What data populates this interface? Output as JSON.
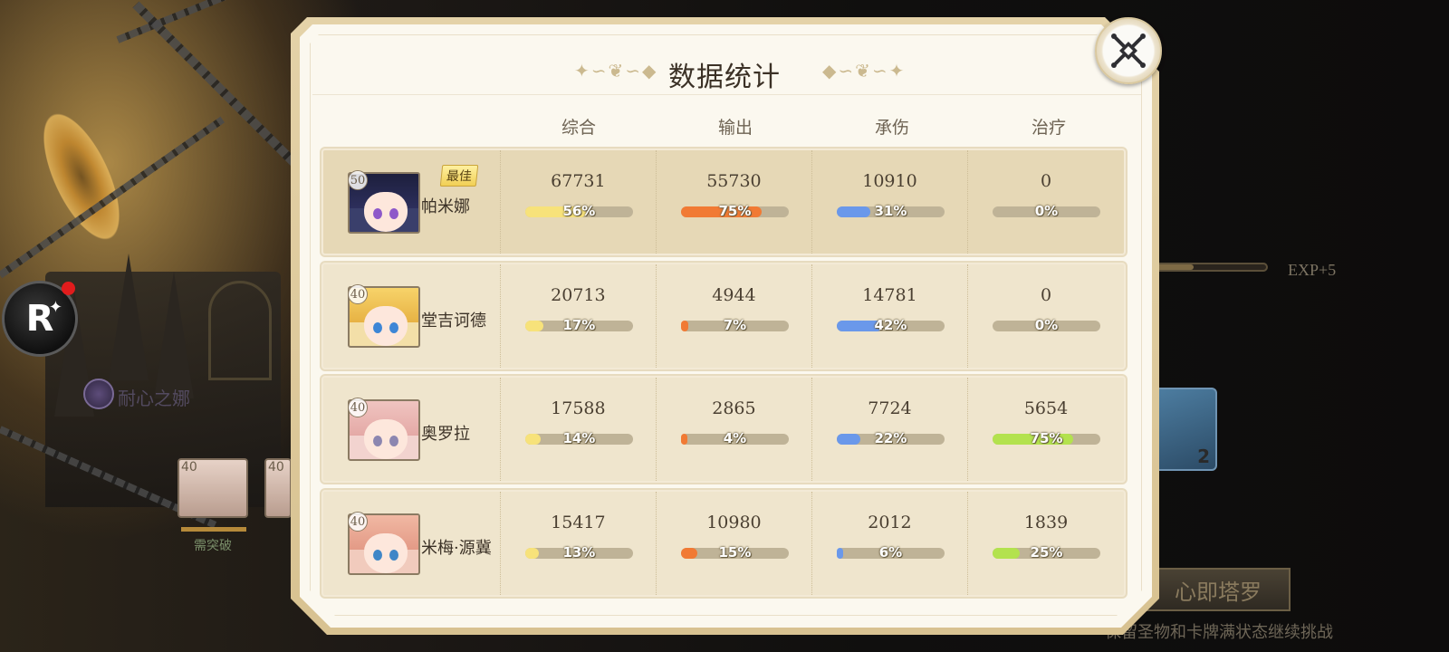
{
  "modal": {
    "title": "数据统计",
    "close_icon": "close-crossed-swords-icon",
    "columns": [
      "综合",
      "输出",
      "承伤",
      "治疗"
    ],
    "best_badge": "最佳",
    "colors": {
      "overall": "#f7e27a",
      "output": "#f17a34",
      "tank": "#6a98ea",
      "heal": "#b3e24e",
      "track": "#bfb397"
    },
    "rows": [
      {
        "name": "帕米娜",
        "level": "50",
        "best": true,
        "stats": [
          {
            "value": "67731",
            "percent": "56%",
            "fill": 0.56
          },
          {
            "value": "55730",
            "percent": "75%",
            "fill": 0.75
          },
          {
            "value": "10910",
            "percent": "31%",
            "fill": 0.31
          },
          {
            "value": "0",
            "percent": "0%",
            "fill": 0
          }
        ]
      },
      {
        "name": "堂吉诃德",
        "level": "40",
        "best": false,
        "stats": [
          {
            "value": "20713",
            "percent": "17%",
            "fill": 0.17
          },
          {
            "value": "4944",
            "percent": "7%",
            "fill": 0.07
          },
          {
            "value": "14781",
            "percent": "42%",
            "fill": 0.42
          },
          {
            "value": "0",
            "percent": "0%",
            "fill": 0
          }
        ]
      },
      {
        "name": "奥罗拉",
        "level": "40",
        "best": false,
        "stats": [
          {
            "value": "17588",
            "percent": "14%",
            "fill": 0.14
          },
          {
            "value": "2865",
            "percent": "4%",
            "fill": 0.04
          },
          {
            "value": "7724",
            "percent": "22%",
            "fill": 0.22
          },
          {
            "value": "5654",
            "percent": "75%",
            "fill": 0.75
          }
        ]
      },
      {
        "name": "米梅·源冀",
        "level": "40",
        "best": false,
        "stats": [
          {
            "value": "15417",
            "percent": "13%",
            "fill": 0.13
          },
          {
            "value": "10980",
            "percent": "15%",
            "fill": 0.15
          },
          {
            "value": "2012",
            "percent": "6%",
            "fill": 0.06
          },
          {
            "value": "1839",
            "percent": "25%",
            "fill": 0.25
          }
        ]
      }
    ]
  },
  "background": {
    "exp_label": "EXP+5",
    "relic_count": "2",
    "action_button": "心即塔罗",
    "hint_text": "保留圣物和卡牌满状态继续挑战",
    "mini_card_level": "40",
    "mini_card_level_2": "40",
    "mini_card_label": "需突破",
    "skill_text": "耐心之娜",
    "r_button_label": "R",
    "r_button_star": "✦"
  }
}
